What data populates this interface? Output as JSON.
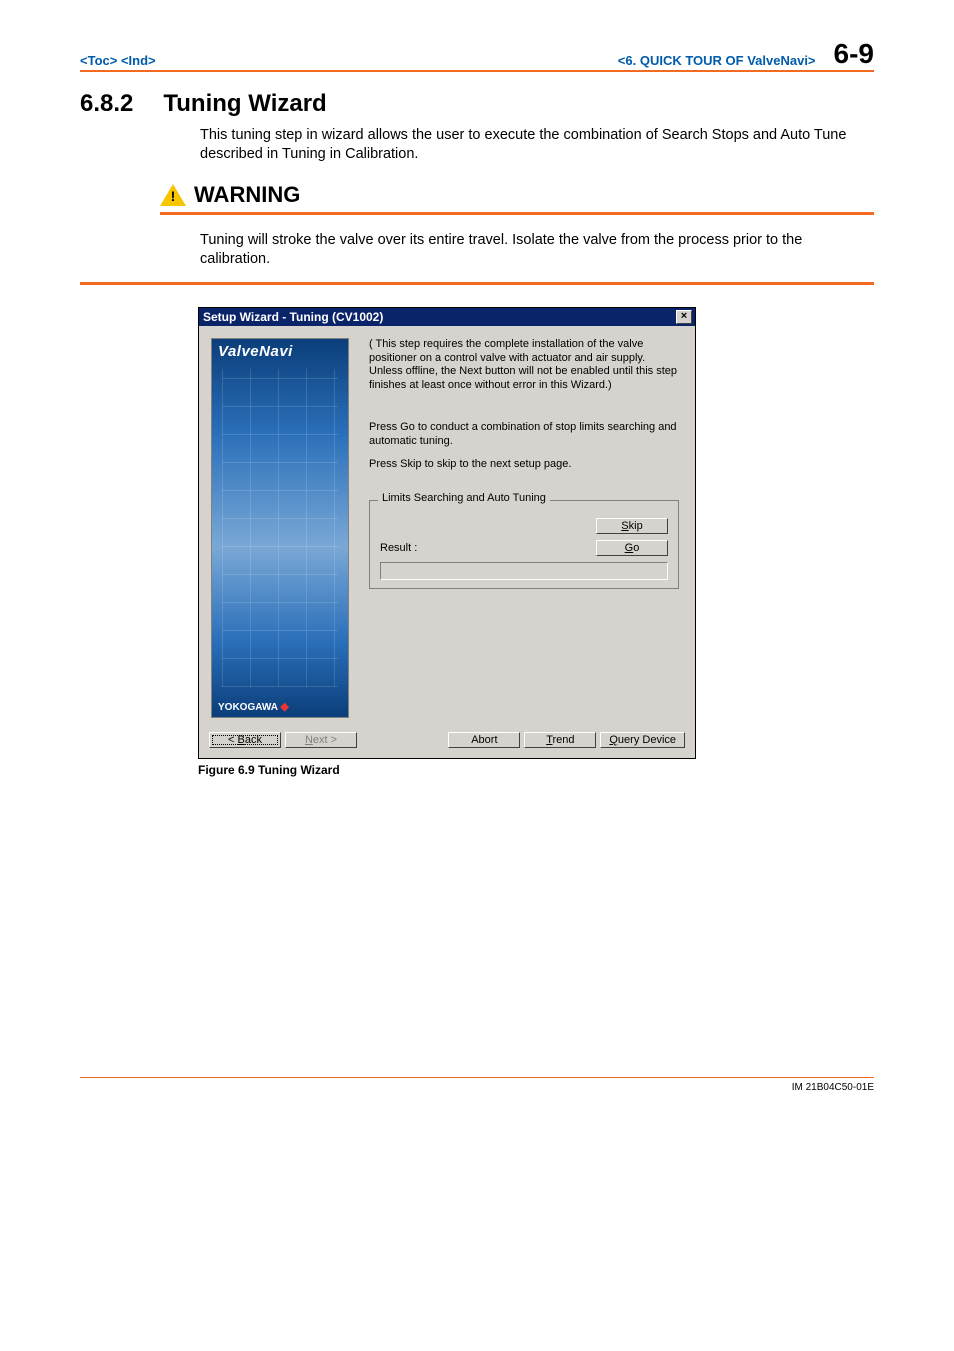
{
  "header": {
    "left": "<Toc> <Ind>",
    "center": "<6.  QUICK TOUR OF ValveNavi>",
    "right": "6-9"
  },
  "section": {
    "number": "6.8.2",
    "title": "Tuning Wizard",
    "body": "This tuning step in wizard allows the user to execute the combination of Search Stops and Auto Tune described in Tuning in Calibration."
  },
  "warning": {
    "label": "WARNING",
    "text": "Tuning will stroke the valve over its entire travel. Isolate the valve from the process prior to the calibration."
  },
  "dialog": {
    "title": "Setup Wizard - Tuning (CV1002)",
    "brand_top": "ValveNavi",
    "brand_bottom": "YOKOGAWA",
    "note": "( This step requires the complete installation of the valve positioner on a control valve with actuator and air supply. Unless offline, the Next button will not be enabled until this step finishes at least once without error in this Wizard.)",
    "press_go": "Press Go to conduct a combination of stop limits searching and automatic tuning.",
    "press_skip": "Press Skip to skip to the next setup page.",
    "group_legend": "Limits Searching and Auto Tuning",
    "skip_label_pre": "S",
    "skip_label_rest": "kip",
    "go_label_pre": "G",
    "go_label_rest": "o",
    "result_label": "Result :",
    "buttons": {
      "back_pre": "< ",
      "back_u": "B",
      "back_rest": "ack",
      "next_pre": "",
      "next_u": "N",
      "next_rest": "ext >",
      "abort": "Abort",
      "trend_u": "T",
      "trend_rest": "rend",
      "query_u": "Q",
      "query_rest": "uery Device"
    }
  },
  "figure_caption": "Figure 6.9 Tuning Wizard",
  "footer": "IM 21B04C50-01E"
}
